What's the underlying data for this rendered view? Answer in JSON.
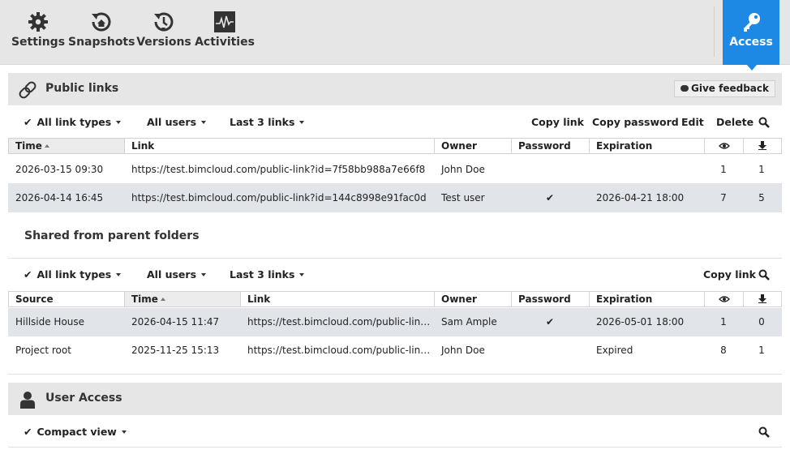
{
  "toolbar": {
    "settings": {
      "label": "Settings",
      "icon": "gear-icon"
    },
    "snapshots": {
      "label": "Snapshots",
      "icon": "snapshot-icon"
    },
    "versions": {
      "label": "Versions",
      "icon": "versions-icon"
    },
    "activities": {
      "label": "Activities",
      "icon": "activity-icon"
    },
    "access": {
      "label": "Access",
      "icon": "key-icon"
    },
    "accent": "#1e88e5"
  },
  "public_links": {
    "title": "Public links",
    "feedback_label": "Give feedback",
    "filters": {
      "link_types": "All link types",
      "users": "All users",
      "count": "Last 3 links",
      "actions": [
        "Copy link",
        "Copy password",
        "Edit",
        "Delete"
      ]
    },
    "columns": [
      "Time",
      "Link",
      "Owner",
      "Password",
      "Expiration",
      "views-icon",
      "downloads-icon"
    ],
    "rows": [
      {
        "time": "2026-03-15 09:30",
        "link": "https://test.bimcloud.com/public-link?id=7f58bb988a7e66f8",
        "owner": "John Doe",
        "password": "",
        "expiration": "",
        "views": "1",
        "downloads": "1",
        "selected": false
      },
      {
        "time": "2026-04-14 16:45",
        "link": "https://test.bimcloud.com/public-link?id=144c8998e91fac0d",
        "owner": "Test user",
        "password": "✔",
        "expiration": "2026-04-21 18:00",
        "views": "7",
        "downloads": "5",
        "selected": true
      }
    ]
  },
  "shared": {
    "title": "Shared from parent folders",
    "filters": {
      "link_types": "All link types",
      "users": "All users",
      "count": "Last 3 links",
      "actions": [
        "Copy link"
      ]
    },
    "columns": [
      "Source",
      "Time",
      "Link",
      "Owner",
      "Password",
      "Expiration",
      "views-icon",
      "downloads-icon"
    ],
    "rows": [
      {
        "source": "Hillside House",
        "time": "2026-04-15 11:47",
        "link": "https://test.bimcloud.com/public-link...",
        "owner": "Sam Ample",
        "password": "✔",
        "expiration": "2026-05-01 18:00",
        "views": "1",
        "downloads": "0",
        "selected": true
      },
      {
        "source": "Project root",
        "time": "2025-11-25 15:13",
        "link": "https://test.bimcloud.com/public-link...",
        "owner": "John Doe",
        "password": "",
        "expiration": "Expired",
        "views": "8",
        "downloads": "1",
        "selected": false
      }
    ]
  },
  "user_access": {
    "title": "User Access",
    "view_mode": "Compact view"
  },
  "check_glyph": "✔"
}
